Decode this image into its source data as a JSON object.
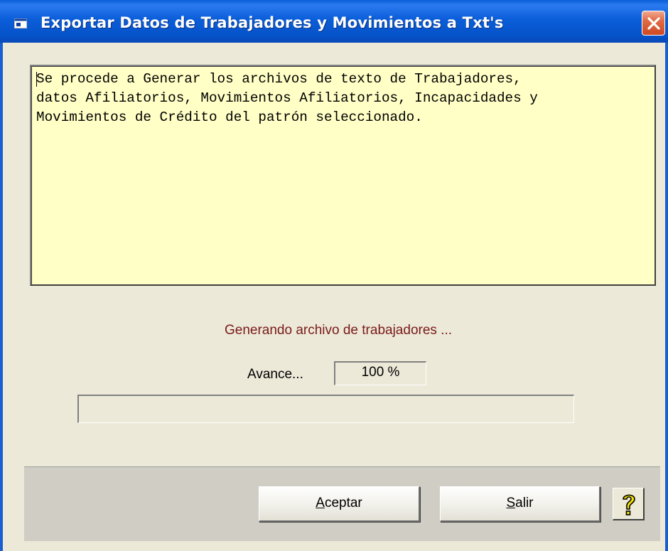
{
  "window": {
    "title": "Exportar Datos de Trabajadores y Movimientos a Txt's"
  },
  "description": {
    "text": "Se procede a Generar los archivos de texto de Trabajadores,\ndatos Afiliatorios, Movimientos Afiliatorios, Incapacidades y\nMovimientos de Crédito del patrón seleccionado."
  },
  "status": {
    "message": "Generando archivo de trabajadores ...",
    "avance_label": "Avance...",
    "avance_value": "100 %",
    "progress_fraction": 0
  },
  "buttons": {
    "aceptar_prefix": "",
    "aceptar_underlined": "A",
    "aceptar_rest": "ceptar",
    "salir_underlined": "S",
    "salir_rest": "alir",
    "help_icon": "help-question-icon"
  },
  "colors": {
    "titlebar": "#0b5ed9",
    "description_bg": "#ffffc6",
    "status_text": "#7a1a1a",
    "dialog_bg": "#ece9d8",
    "button_panel": "#cfcdc4"
  }
}
